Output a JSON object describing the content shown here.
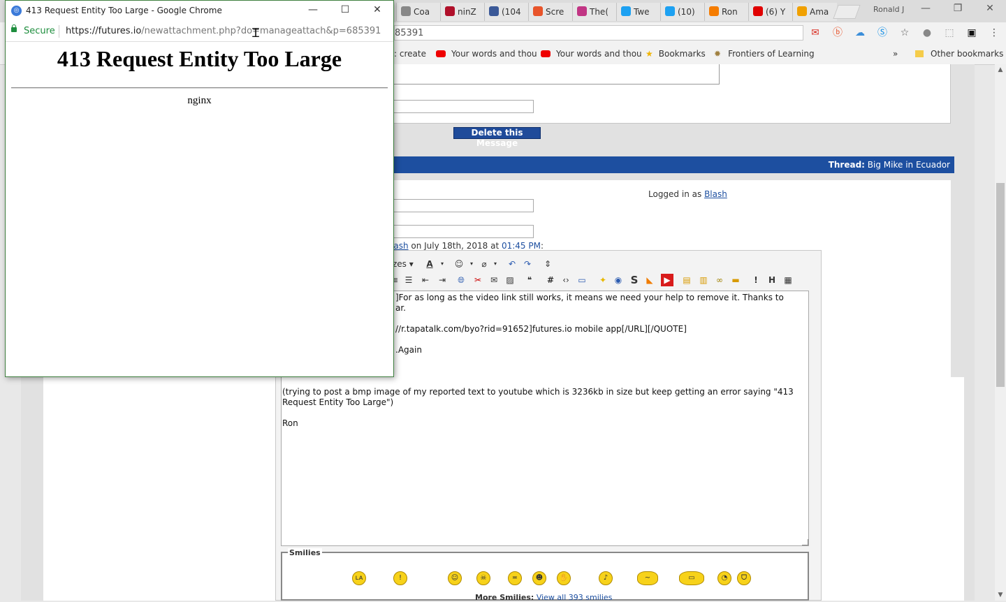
{
  "popup": {
    "window_title": "413 Request Entity Too Large - Google Chrome",
    "secure_label": "Secure",
    "url_host": "https://futures.io",
    "url_path": "/newattachment.php?do=manageattach&p=685391",
    "heading": "413 Request Entity Too Large",
    "server": "nginx",
    "controls": [
      "—",
      "☐",
      "✕"
    ]
  },
  "browser": {
    "tabs": [
      {
        "label": "Coa",
        "icon": "document-icon",
        "color": "#888888"
      },
      {
        "label": "ninZ",
        "icon": "ninja-icon",
        "color": "#b0102a"
      },
      {
        "label": "(104",
        "icon": "facebook-icon",
        "color": "#3b5998"
      },
      {
        "label": "Scre",
        "icon": "g-icon",
        "color": "#e8542a"
      },
      {
        "label": "The(",
        "icon": "instagram-icon",
        "color": "#c13584"
      },
      {
        "label": "Twe",
        "icon": "twitter-icon",
        "color": "#1da1f2"
      },
      {
        "label": "(10)",
        "icon": "twitter-icon",
        "color": "#1da1f2"
      },
      {
        "label": "Ron",
        "icon": "play-icon",
        "color": "#f57c00"
      },
      {
        "label": "(6) Y",
        "icon": "youtube-icon",
        "color": "#e00000"
      },
      {
        "label": "Ama",
        "icon": "amazon-icon",
        "color": "#f0a000"
      }
    ],
    "profile_name": "Ronald J",
    "omnibox_text": "85391",
    "bookmarks": [
      ": create",
      "Your words and thou",
      "Your words and thou",
      "Bookmarks",
      "Frontiers of Learning"
    ],
    "bookmarks_overflow": "»",
    "other_bookmarks": "Other bookmarks"
  },
  "page": {
    "delete_button": "Delete this Message",
    "thread_label": "Thread:",
    "thread_title": "Big Mike in Ecuador",
    "logged_in_prefix": "Logged in as",
    "logged_in_user": "Blash",
    "edited_user_fragment": "lash",
    "edited_text": "on July 18th, 2018 at",
    "edited_time": "01:45 PM",
    "edited_colon": ":",
    "font_size_select": "zes",
    "message_lines": [
      "]For as long as the video link still works, it means we need your help to remove it. Thanks to",
      "ar.",
      "//r.tapatalk.com/byo?rid=91652]futures.io mobile app[/URL][/QUOTE]",
      ".Again",
      "(trying to post a bmp image of my reported text to youtube which is 3236kb in size but keep getting an error saying \"413",
      "Request Entity Too Large\")",
      "Ron"
    ],
    "smilies_legend": "Smilies",
    "more_smilies_label": "More Smilies:",
    "more_smilies_link": "View all 393 smilies"
  }
}
